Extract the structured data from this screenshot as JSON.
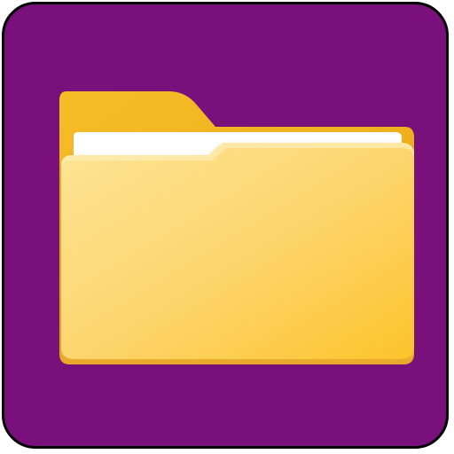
{
  "icon": {
    "name": "folder-icon",
    "colors": {
      "background": "#7a107c",
      "border": "#000000",
      "folder_back": "#f3b51e",
      "folder_front_light": "#fde38f",
      "folder_front_dark": "#fdc52b",
      "paper": "#ffffff"
    }
  }
}
